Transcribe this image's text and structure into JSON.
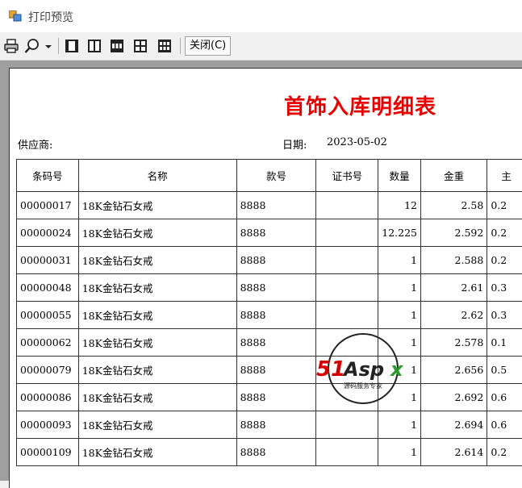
{
  "window": {
    "title": "打印预览"
  },
  "toolbar": {
    "icons": [
      "print-icon",
      "zoom-icon",
      "dropdown-arrow-icon",
      "one-page-icon",
      "two-pages-icon",
      "three-pages-icon",
      "four-pages-icon",
      "six-pages-icon"
    ],
    "close_label": "关闭(C)"
  },
  "report": {
    "title": "首饰入库明细表",
    "supplier_label": "供应商:",
    "date_label": "日期:",
    "date_value": "2023-05-02",
    "columns": [
      "条码号",
      "名称",
      "款号",
      "证书号",
      "数量",
      "金重",
      "主"
    ],
    "rows": [
      {
        "code": "00000017",
        "name": "18K金钻石女戒",
        "style": "8888",
        "cert": "",
        "qty": "12",
        "gold": "2.58",
        "main": "0.2"
      },
      {
        "code": "00000024",
        "name": "18K金钻石女戒",
        "style": "8888",
        "cert": "",
        "qty": "12.225",
        "gold": "2.592",
        "main": "0.2"
      },
      {
        "code": "00000031",
        "name": "18K金钻石女戒",
        "style": "8888",
        "cert": "",
        "qty": "1",
        "gold": "2.588",
        "main": "0.2"
      },
      {
        "code": "00000048",
        "name": "18K金钻石女戒",
        "style": "8888",
        "cert": "",
        "qty": "1",
        "gold": "2.61",
        "main": "0.3"
      },
      {
        "code": "00000055",
        "name": "18K金钻石女戒",
        "style": "8888",
        "cert": "",
        "qty": "1",
        "gold": "2.62",
        "main": "0.3"
      },
      {
        "code": "00000062",
        "name": "18K金钻石女戒",
        "style": "8888",
        "cert": "",
        "qty": "1",
        "gold": "2.578",
        "main": "0.1"
      },
      {
        "code": "00000079",
        "name": "18K金钻石女戒",
        "style": "8888",
        "cert": "",
        "qty": "1",
        "gold": "2.656",
        "main": "0.5"
      },
      {
        "code": "00000086",
        "name": "18K金钻石女戒",
        "style": "8888",
        "cert": "",
        "qty": "1",
        "gold": "2.692",
        "main": "0.6"
      },
      {
        "code": "00000093",
        "name": "18K金钻石女戒",
        "style": "8888",
        "cert": "",
        "qty": "1",
        "gold": "2.694",
        "main": "0.6"
      },
      {
        "code": "00000109",
        "name": "18K金钻石女戒",
        "style": "8888",
        "cert": "",
        "qty": "1",
        "gold": "2.614",
        "main": "0.2"
      }
    ]
  },
  "watermark": {
    "brand": "51Aspx",
    "tagline": "源码服务专家"
  }
}
